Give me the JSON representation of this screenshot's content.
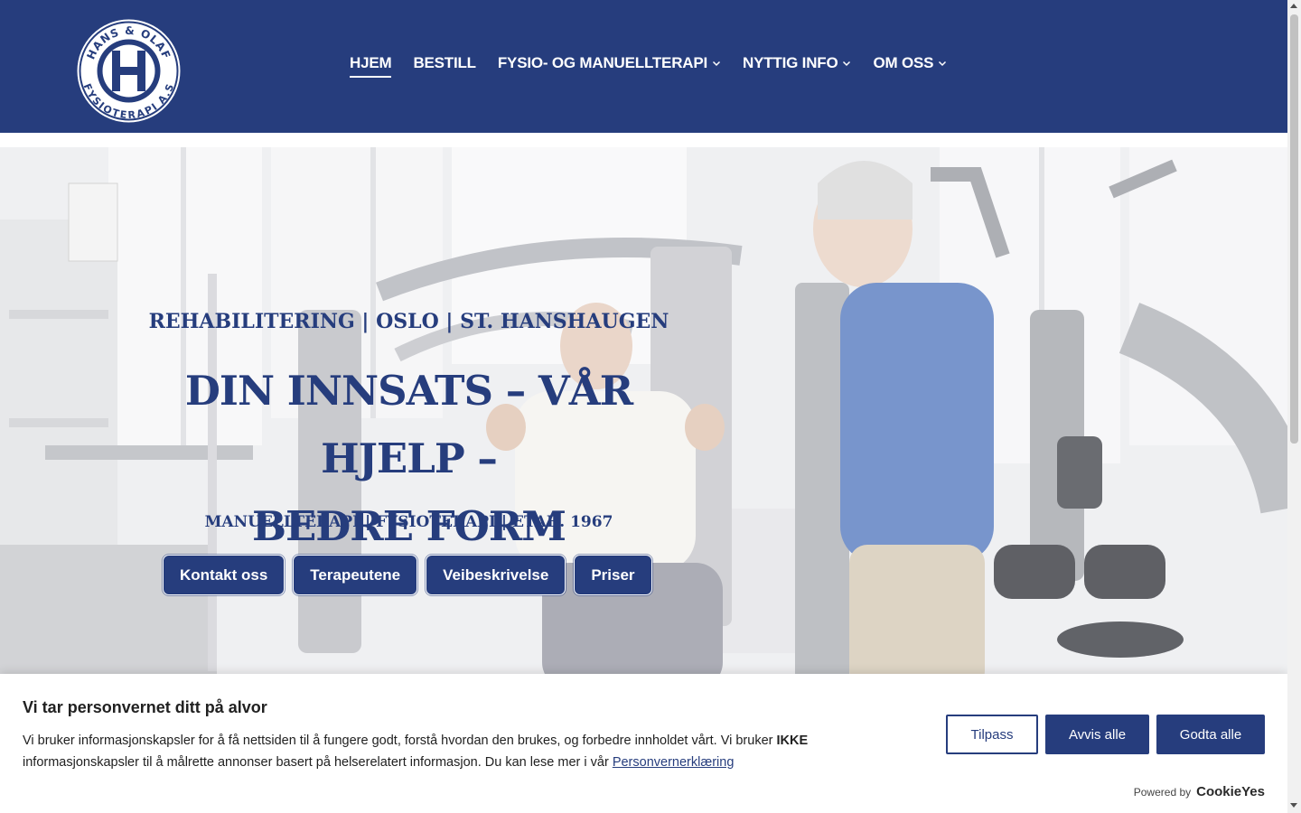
{
  "header": {
    "logo_alt": "Hans & Olaf Fysioterapi A.S logo",
    "logo_letter": "H",
    "logo_ring_text_top": "HANS & OLAF",
    "logo_ring_text_bottom": "FYSIOTERAPI A.S",
    "nav": [
      {
        "label": "HJEM",
        "active": true,
        "dropdown": false
      },
      {
        "label": "BESTILL",
        "active": false,
        "dropdown": false
      },
      {
        "label": "FYSIO- OG MANUELLTERAPI",
        "active": false,
        "dropdown": true
      },
      {
        "label": "NYTTIG INFO",
        "active": false,
        "dropdown": true
      },
      {
        "label": "OM OSS",
        "active": false,
        "dropdown": true
      }
    ]
  },
  "hero": {
    "kicker_top": "REHABILITERING | OSLO | ST. HANSHAUGEN",
    "headline_line1": "DIN INNSATS – VÅR HJELP –",
    "headline_line2": "BEDRE FORM",
    "kicker_bottom": "MANUELLTERAPI | FYSIOTERAPI | ETAB. 1967",
    "buttons": [
      "Kontakt oss",
      "Terapeutene",
      "Veibeskrivelse",
      "Priser"
    ]
  },
  "cookie": {
    "title": "Vi tar personvernet ditt på alvor",
    "text_part1": "Vi bruker informasjonskapsler for å få nettsiden til å fungere godt, forstå hvordan den brukes, og forbedre innholdet vårt. Vi bruker ",
    "text_bold": "IKKE",
    "text_part2": " informasjonskapsler til å målrette annonser basert på helserelatert informasjon. Du kan lese mer i vår ",
    "link_text": "Personvernerklæring",
    "btn_customize": "Tilpass",
    "btn_reject": "Avvis alle",
    "btn_accept": "Godta alle",
    "powered_by": "Powered by",
    "powered_brand": "CookieYes"
  },
  "colors": {
    "brand": "#263d7d",
    "white": "#ffffff"
  }
}
